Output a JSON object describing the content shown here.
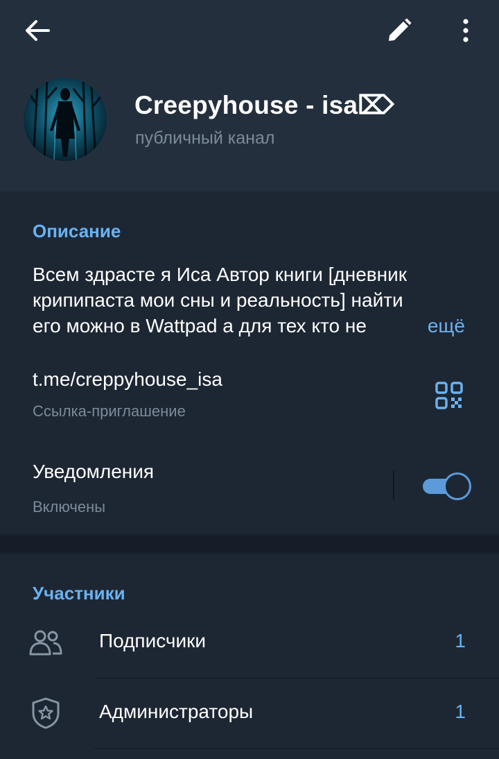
{
  "header": {
    "title": "Creepyhouse - isa⌦",
    "subtitle": "публичный канал"
  },
  "info": {
    "description_title": "Описание",
    "description_lines": [
      "Всем здрасте я Иса Автор книги [дневник",
      "крипипаста мои сны и реальность] найти",
      "его можно в Wattpad а для тех кто не"
    ],
    "more_label": "ещё",
    "link": "t.me/creppyhouse_isa",
    "link_label": "Ссылка-приглашение",
    "notifications_title": "Уведомления",
    "notifications_status": "Включены",
    "notifications_enabled": true
  },
  "members": {
    "section_title": "Участники",
    "items": [
      {
        "label": "Подписчики",
        "count": "1",
        "icon": "people-icon"
      },
      {
        "label": "Администраторы",
        "count": "1",
        "icon": "shield-star-icon"
      }
    ]
  },
  "colors": {
    "accent": "#6ab2f2",
    "header_bg": "#242f3d",
    "body_bg": "#1d2733",
    "muted_text": "#7d8b99",
    "toggle_on": "#5b9bd9"
  },
  "icons": [
    "arrow-left-icon",
    "pencil-icon",
    "more-vertical-icon",
    "qr-code-icon"
  ]
}
